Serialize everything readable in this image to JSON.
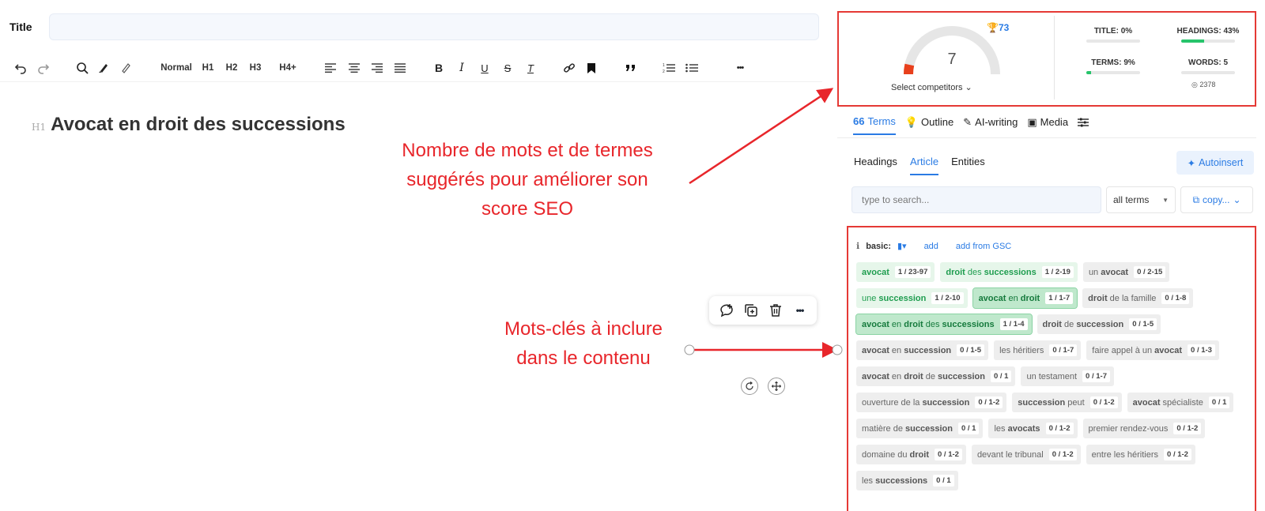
{
  "editor": {
    "title_label": "Title",
    "h1_marker": "H1",
    "h1_text": "Avocat en droit des successions"
  },
  "toolbar": {
    "normal": "Normal",
    "h1": "H1",
    "h2": "H2",
    "h3": "H3",
    "h4": "H4+",
    "bold": "B",
    "italic": "I",
    "underline": "U",
    "strike": "S",
    "clear": "T",
    "more": "•••"
  },
  "annotations": {
    "first": "Nombre de mots et de termes suggérés pour améliorer son score SEO",
    "second": "Mots-clés à inclure dans le contenu",
    "color": "#e8262b"
  },
  "score": {
    "value": "7",
    "trophy": "73",
    "select_competitors": "Select competitors",
    "metrics": {
      "title": {
        "label": "TITLE: 0%",
        "progress": 0
      },
      "headings": {
        "label": "HEADINGS: 43%",
        "progress": 0.43
      },
      "terms": {
        "label": "TERMS: 9%",
        "progress": 0.09
      },
      "words": {
        "label": "WORDS: 5",
        "sub": "2378"
      }
    }
  },
  "tabs": [
    "Terms",
    "Outline",
    "AI-writing",
    "Media"
  ],
  "subtabs": [
    "Headings",
    "Article",
    "Entities"
  ],
  "autoinsert": "Autoinsert",
  "search": {
    "placeholder": "type to search..."
  },
  "filter": {
    "value": "all terms"
  },
  "copy": "copy...",
  "basic": {
    "label": "basic:",
    "add": "add",
    "add_gsc": "add from GSC"
  },
  "terms": [
    {
      "html": "<b>avocat</b>",
      "count": "1 / 23-97",
      "state": "g1"
    },
    {
      "html": "<b>droit</b> des <b>successions</b>",
      "count": "1 / 2-19",
      "state": "g1"
    },
    {
      "html": "un <b>avocat</b>",
      "count": "0 / 2-15",
      "state": ""
    },
    {
      "html": "une <b>succession</b>",
      "count": "1 / 2-10",
      "state": "g1"
    },
    {
      "html": "<b>avocat</b> en <b>droit</b>",
      "count": "1 / 1-7",
      "state": "g2"
    },
    {
      "html": "<b>droit</b> de la famille",
      "count": "0 / 1-8",
      "state": ""
    },
    {
      "html": "<b>avocat</b> en <b>droit</b> des <b>successions</b>",
      "count": "1 / 1-4",
      "state": "g2"
    },
    {
      "html": "<b>droit</b> de <b>succession</b>",
      "count": "0 / 1-5",
      "state": ""
    },
    {
      "html": "<b>avocat</b> en <b>succession</b>",
      "count": "0 / 1-5",
      "state": ""
    },
    {
      "html": "les héritiers",
      "count": "0 / 1-7",
      "state": ""
    },
    {
      "html": "faire appel à un <b>avocat</b>",
      "count": "0 / 1-3",
      "state": ""
    },
    {
      "html": "<b>avocat</b> en <b>droit</b> de <b>succession</b>",
      "count": "0 / 1",
      "state": ""
    },
    {
      "html": "un testament",
      "count": "0 / 1-7",
      "state": ""
    },
    {
      "html": "ouverture de la <b>succession</b>",
      "count": "0 / 1-2",
      "state": ""
    },
    {
      "html": "<b>succession</b> peut",
      "count": "0 / 1-2",
      "state": ""
    },
    {
      "html": "<b>avocat</b> spécialiste",
      "count": "0 / 1",
      "state": ""
    },
    {
      "html": "matière de <b>succession</b>",
      "count": "0 / 1",
      "state": ""
    },
    {
      "html": "les <b>avocats</b>",
      "count": "0 / 1-2",
      "state": ""
    },
    {
      "html": "premier rendez-vous",
      "count": "0 / 1-2",
      "state": ""
    },
    {
      "html": "domaine du <b>droit</b>",
      "count": "0 / 1-2",
      "state": ""
    },
    {
      "html": "devant le tribunal",
      "count": "0 / 1-2",
      "state": ""
    },
    {
      "html": "entre les héritiers",
      "count": "0 / 1-2",
      "state": ""
    },
    {
      "html": "les <b>successions</b>",
      "count": "0 / 1",
      "state": ""
    }
  ]
}
